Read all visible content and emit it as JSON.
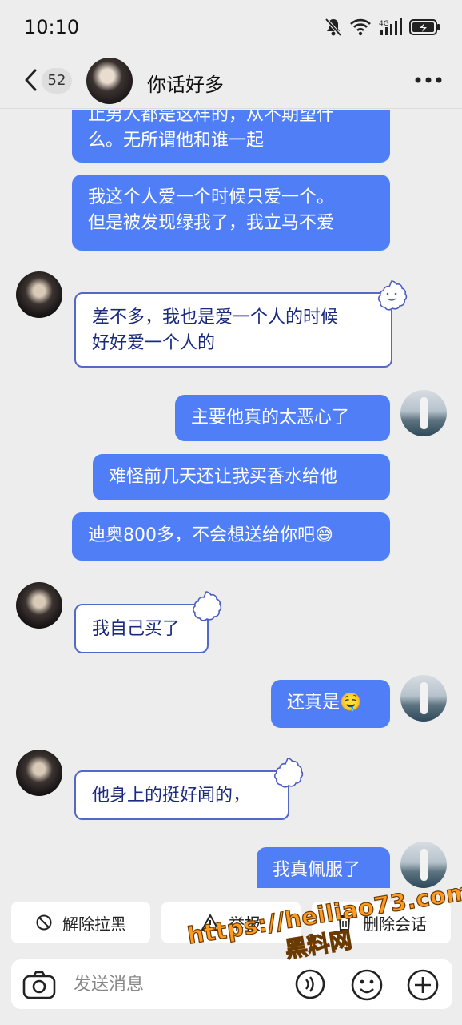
{
  "status_bar": {
    "time": "10:10",
    "network_label": "4G",
    "icons": [
      "mute-bell-icon",
      "wifi-icon",
      "signal-icon",
      "battery-charging-icon"
    ]
  },
  "header": {
    "unread_count": "52",
    "title": "你话好多",
    "icons": [
      "back-icon",
      "more-icon"
    ]
  },
  "messages": [
    {
      "side": "out",
      "lines": [
        "止男人都是这样的，从不期望什",
        "么。无所谓他和谁一起"
      ]
    },
    {
      "side": "out",
      "lines": [
        "我这个人爱一个时候只爱一个。",
        "但是被发现绿我了，我立马不爱"
      ]
    },
    {
      "side": "in",
      "lines": [
        "差不多，我也是爱一个人的时候",
        "好好爱一个人的"
      ]
    },
    {
      "side": "out",
      "lines": [
        "主要他真的太恶心了"
      ]
    },
    {
      "side": "out",
      "lines": [
        "难怪前几天还让我买香水给他"
      ]
    },
    {
      "side": "out",
      "lines": [
        "迪奥800多，不会想送给你吧"
      ],
      "emoji": "😅"
    },
    {
      "side": "in",
      "lines": [
        "我自己买了"
      ]
    },
    {
      "side": "out",
      "lines": [
        "还真是"
      ],
      "emoji": "🤤"
    },
    {
      "side": "in",
      "lines": [
        "他身上的挺好闻的，"
      ]
    },
    {
      "side": "out",
      "lines": [
        "我真佩服了"
      ]
    }
  ],
  "actions": {
    "unblock": "解除拉黑",
    "report": "举报",
    "delete": "删除会话"
  },
  "input": {
    "placeholder": "发送消息"
  },
  "watermark": {
    "url": "https://heiliao73.com",
    "name": "黑料网"
  },
  "colors": {
    "outgoing_bubble": "#4f7ef6",
    "incoming_border": "#5468c7",
    "incoming_text": "#1a2a7e",
    "background": "#ededed",
    "watermark": "#ff9a1e"
  }
}
